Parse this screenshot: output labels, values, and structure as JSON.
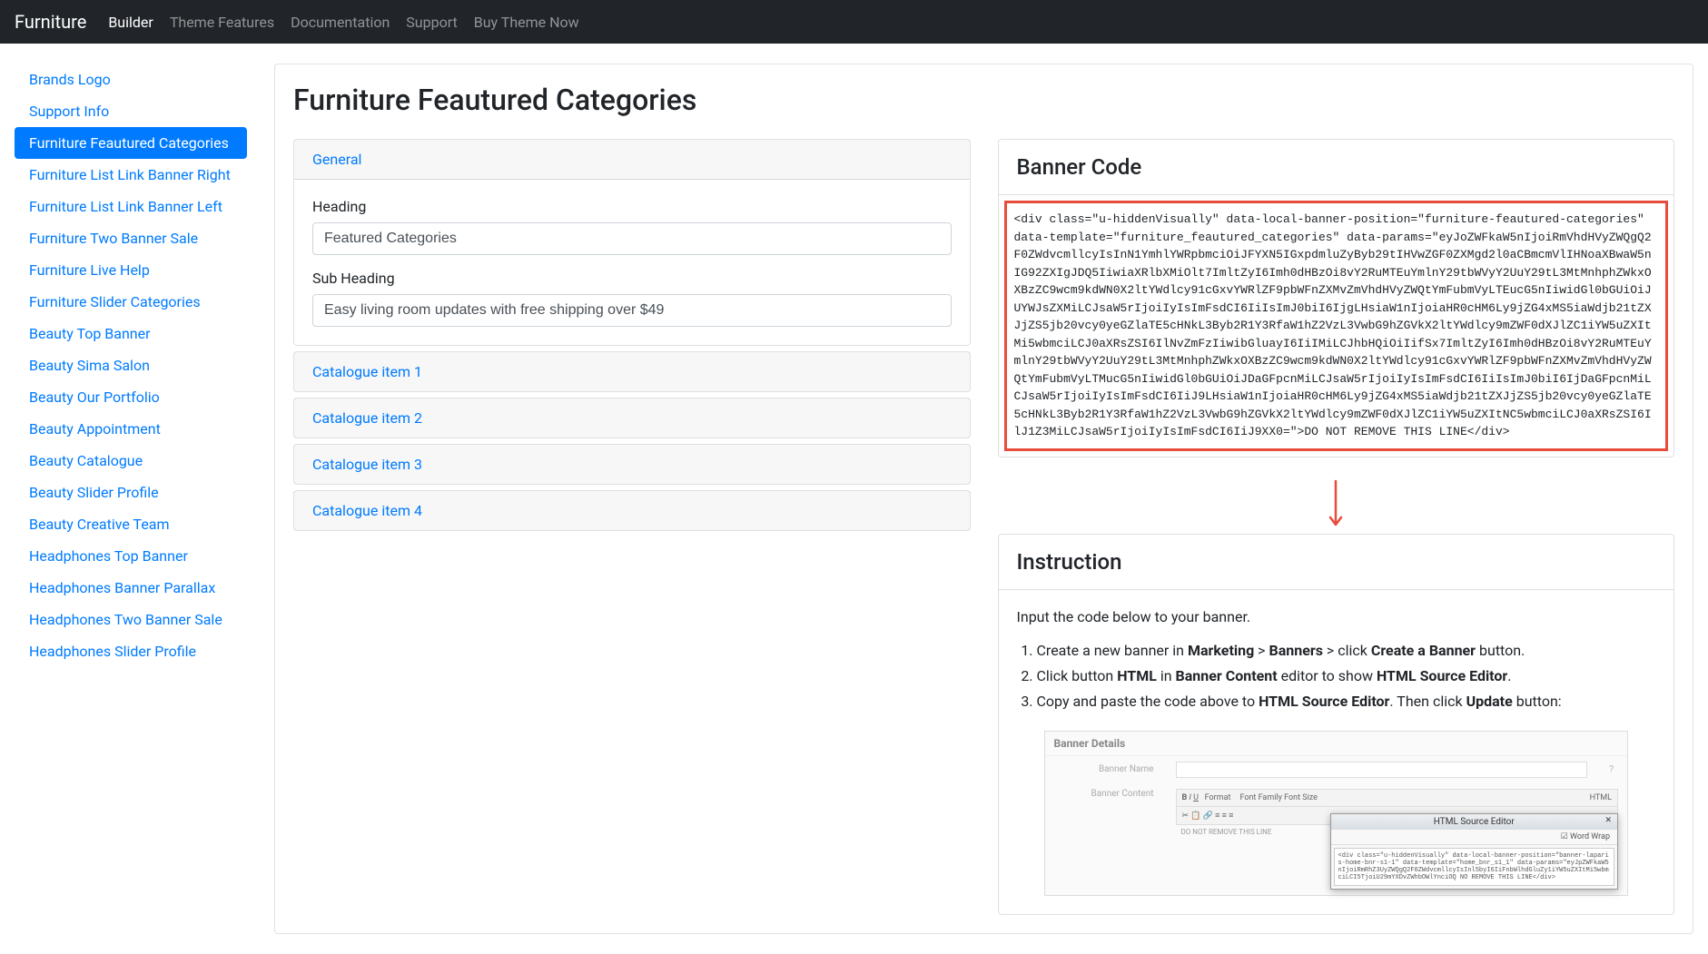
{
  "navbar": {
    "brand": "Furniture",
    "links": [
      {
        "label": "Builder",
        "active": true
      },
      {
        "label": "Theme Features",
        "active": false
      },
      {
        "label": "Documentation",
        "active": false
      },
      {
        "label": "Support",
        "active": false
      },
      {
        "label": "Buy Theme Now",
        "active": false
      }
    ]
  },
  "sidebar": {
    "items": [
      {
        "label": "Brands Logo",
        "active": false
      },
      {
        "label": "Support Info",
        "active": false
      },
      {
        "label": "Furniture Feautured Categories",
        "active": true
      },
      {
        "label": "Furniture List Link Banner Right",
        "active": false
      },
      {
        "label": "Furniture List Link Banner Left",
        "active": false
      },
      {
        "label": "Furniture Two Banner Sale",
        "active": false
      },
      {
        "label": "Furniture Live Help",
        "active": false
      },
      {
        "label": "Furniture Slider Categories",
        "active": false
      },
      {
        "label": "Beauty Top Banner",
        "active": false
      },
      {
        "label": "Beauty Sima Salon",
        "active": false
      },
      {
        "label": "Beauty Our Portfolio",
        "active": false
      },
      {
        "label": "Beauty Appointment",
        "active": false
      },
      {
        "label": "Beauty Catalogue",
        "active": false
      },
      {
        "label": "Beauty Slider Profile",
        "active": false
      },
      {
        "label": "Beauty Creative Team",
        "active": false
      },
      {
        "label": "Headphones Top Banner",
        "active": false
      },
      {
        "label": "Headphones Banner Parallax",
        "active": false
      },
      {
        "label": "Headphones Two Banner Sale",
        "active": false
      },
      {
        "label": "Headphones Slider Profile",
        "active": false
      }
    ]
  },
  "page": {
    "title": "Furniture Feautured Categories"
  },
  "accordion": {
    "general": {
      "title": "General",
      "heading_label": "Heading",
      "heading_value": "Featured Categories",
      "subheading_label": "Sub Heading",
      "subheading_value": "Easy living room updates with free shipping over $49"
    },
    "items": [
      "Catalogue item 1",
      "Catalogue item 2",
      "Catalogue item 3",
      "Catalogue item 4"
    ]
  },
  "bannerCode": {
    "title": "Banner Code",
    "code": "<div class=\"u-hiddenVisually\" data-local-banner-position=\"furniture-feautured-categories\" data-template=\"furniture_feautured_categories\" data-params=\"eyJoZWFkaW5nIjoiRmVhdHVyZWQgQ2F0ZWdvcmllcyIsInN1YmhlYWRpbmciOiJFYXN5IGxpdmluZyByb29tIHVwZGF0ZXMgd2l0aCBmcmVlIHNoaXBwaW5nIG92ZXIgJDQ5IiwiaXRlbXMiOlt7ImltZyI6Imh0dHBzOi8vY2RuMTEuYmlnY29tbWVyY2UuY29tL3MtMnhphZWkxOXBzZC9wcm9kdWN0X2ltYWdlcy91cGxvYWRlZF9pbWFnZXMvZmVhdHVyZWQtYmFubmVyLTEucG5nIiwidGl0bGUiOiJUYWJsZXMiLCJsaW5rIjoiIyIsImFsdCI6IiIsImJ0biI6IjgLHsiaW1nIjoiaHR0cHM6Ly9jZG4xMS5iaWdjb21tZXJjZS5jb20vcy0yeGZlaTE5cHNkL3Byb2R1Y3RfaW1hZ2VzL3VwbG9hZGVkX2ltYWdlcy9mZWF0dXJlZC1iYW5uZXItMi5wbmciLCJ0aXRsZSI6IlNvZmFzIiwibGluayI6IiIMiLCJhbHQiOiIifSx7ImltZyI6Imh0dHBzOi8vY2RuMTEuYmlnY29tbWVyY2UuY29tL3MtMnhphZWkxOXBzZC9wcm9kdWN0X2ltYWdlcy91cGxvYWRlZF9pbWFnZXMvZmVhdHVyZWQtYmFubmVyLTMucG5nIiwidGl0bGUiOiJDaGFpcnMiLCJsaW5rIjoiIyIsImFsdCI6IiIsImJ0biI6IjDaGFpcnMiLCJsaW5rIjoiIyIsImFsdCI6IiJ9LHsiaW1nIjoiaHR0cHM6Ly9jZG4xMS5iaWdjb21tZXJjZS5jb20vcy0yeGZlaTE5cHNkL3Byb2R1Y3RfaW1hZ2VzL3VwbG9hZGVkX2ltYWdlcy9mZWF0dXJlZC1iYW5uZXItNC5wbmciLCJ0aXRsZSI6IlJ1Z3MiLCJsaW5rIjoiIyIsImFsdCI6IiJ9XX0=\">DO NOT REMOVE THIS LINE</div>"
  },
  "instruction": {
    "title": "Instruction",
    "intro": "Input the code below to your banner.",
    "steps": [
      {
        "pre": "Create a new banner in ",
        "b1": "Marketing",
        "mid1": " > ",
        "b2": "Banners",
        "mid2": " > click ",
        "b3": "Create a Banner",
        "post": " button."
      },
      {
        "pre": "Click button ",
        "b1": "HTML",
        "mid1": " in ",
        "b2": "Banner Content",
        "mid2": " editor to show ",
        "b3": "HTML Source Editor",
        "post": "."
      },
      {
        "pre": "Copy and paste the code above to ",
        "b1": "HTML Source Editor",
        "mid1": ". Then click ",
        "b2": "Update",
        "mid2": "",
        "b3": "",
        "post": " button:"
      }
    ],
    "mock": {
      "header": "Banner Details",
      "bannerNameLabel": "Banner Name",
      "bannerContentLabel": "Banner Content",
      "toolbarText": "Font Family   Font Size",
      "removeLine": "DO NOT REMOVE THIS LINE",
      "popupTitle": "HTML Source Editor",
      "popupWrap": "☑ Word Wrap",
      "popupCode": "<div class=\"u-hiddenVisually\" data-local-banner-position=\"banner-laparis-home-bnr-s1-1\" data-template=\"home_bnr_s1_1\" data-params=\"eyJpZWFkaW5nIjoiRmRhZ3UyZWQgQ2F0ZWdvcmllcyIsInl5byI6IiFnbWlhdGluZy1iYW5uZXItMi5wbmciLCI5TjoiU29mYXDvZWhbOWlYnciOQ NO REMOVE THIS LINE</div>"
    }
  }
}
